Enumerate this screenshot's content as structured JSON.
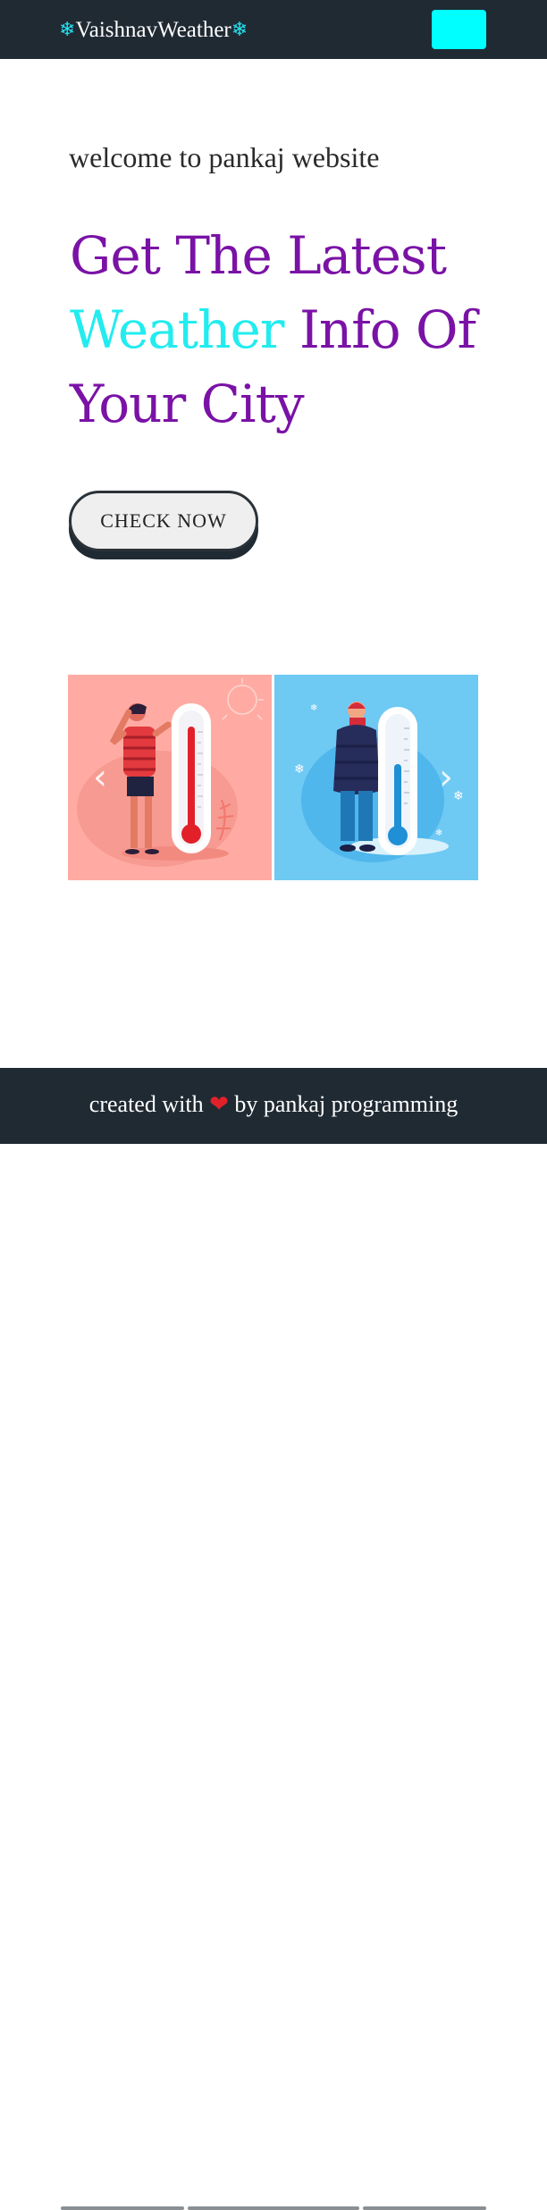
{
  "navbar": {
    "brand": "VaishnavWeather",
    "brand_icon": "snowflake-icon",
    "menu_button_color": "#00ffff"
  },
  "hero": {
    "welcome": "welcome to pankaj website",
    "headline_part1": "Get The Latest",
    "headline_highlight": "Weather",
    "headline_part2": "Info Of Your City",
    "cta_label": "CHECK NOW"
  },
  "carousel": {
    "slides": [
      "hot-weather-thermometer-illustration",
      "cold-weather-thermometer-illustration"
    ],
    "prev_icon": "chevron-left-icon",
    "next_icon": "chevron-right-icon"
  },
  "footer": {
    "text_before": "created with",
    "heart_icon": "heart-icon",
    "text_after": "by pankaj programming"
  },
  "colors": {
    "navbar_bg": "#1f2a33",
    "headline": "#7a12a6",
    "highlight": "#22ecef",
    "hot_slide_bg": "#ffaba3",
    "cold_slide_bg": "#6ec9f3"
  }
}
